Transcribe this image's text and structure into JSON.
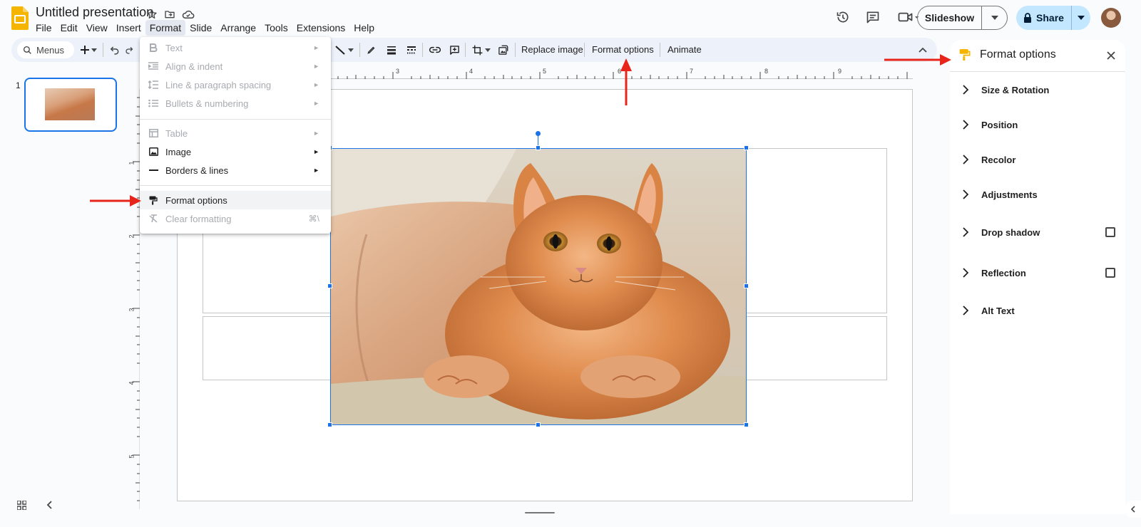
{
  "app": {
    "title": "Untitled presentation",
    "menus": [
      "File",
      "Edit",
      "View",
      "Insert",
      "Format",
      "Slide",
      "Arrange",
      "Tools",
      "Extensions",
      "Help"
    ],
    "active_menu": "Format"
  },
  "header": {
    "slideshow_label": "Slideshow",
    "share_label": "Share"
  },
  "toolbar": {
    "search_label": "Menus",
    "replace_image": "Replace image",
    "format_options": "Format options",
    "animate": "Animate"
  },
  "ruler": {
    "labels": [
      "3",
      "4",
      "5",
      "6",
      "7",
      "8",
      "9"
    ],
    "vertical_labels": [
      "1",
      "2",
      "3",
      "4",
      "5"
    ]
  },
  "filmstrip": {
    "slide_number": "1"
  },
  "format_menu": {
    "items": [
      {
        "label": "Text",
        "icon": "bold-icon",
        "disabled": true,
        "submenu": true
      },
      {
        "label": "Align & indent",
        "icon": "align-icon",
        "disabled": true,
        "submenu": true
      },
      {
        "label": "Line & paragraph spacing",
        "icon": "spacing-icon",
        "disabled": true,
        "submenu": true
      },
      {
        "label": "Bullets & numbering",
        "icon": "list-icon",
        "disabled": true,
        "submenu": true
      },
      {
        "label": "Table",
        "icon": "table-icon",
        "disabled": true,
        "submenu": true
      },
      {
        "label": "Image",
        "icon": "image-icon",
        "disabled": false,
        "submenu": true
      },
      {
        "label": "Borders & lines",
        "icon": "line-icon",
        "disabled": false,
        "submenu": true
      },
      {
        "label": "Format options",
        "icon": "paint-format-icon",
        "disabled": false,
        "submenu": false
      },
      {
        "label": "Clear formatting",
        "icon": "clear-format-icon",
        "disabled": true,
        "submenu": false,
        "shortcut": "⌘\\"
      }
    ]
  },
  "format_panel": {
    "title": "Format options",
    "sections": [
      {
        "label": "Size & Rotation",
        "checkbox": false
      },
      {
        "label": "Position",
        "checkbox": false
      },
      {
        "label": "Recolor",
        "checkbox": false
      },
      {
        "label": "Adjustments",
        "checkbox": false
      },
      {
        "label": "Drop shadow",
        "checkbox": true,
        "checked": false
      },
      {
        "label": "Reflection",
        "checkbox": true,
        "checked": false
      },
      {
        "label": "Alt Text",
        "checkbox": false
      }
    ]
  },
  "colors": {
    "accent": "#1a73e8",
    "share_bg": "#c2e7ff",
    "annotation_arrow": "#e8251a",
    "slides_logo": "#f4b400"
  }
}
